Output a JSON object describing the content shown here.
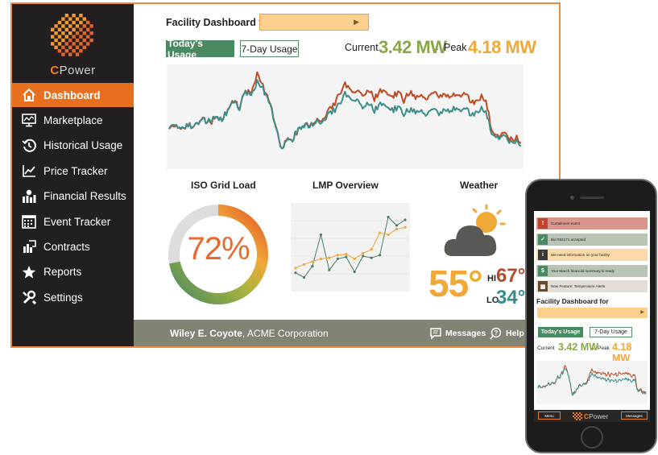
{
  "brand": {
    "logo_c": "C",
    "logo_rest": "Power"
  },
  "sidebar": {
    "items": [
      {
        "label": "Dashboard",
        "icon": "home-icon",
        "active": true
      },
      {
        "label": "Marketplace",
        "icon": "monitor-chart-icon"
      },
      {
        "label": "Historical Usage",
        "icon": "history-icon"
      },
      {
        "label": "Price Tracker",
        "icon": "trend-line-icon"
      },
      {
        "label": "Financial Results",
        "icon": "money-bars-icon"
      },
      {
        "label": "Event Tracker",
        "icon": "calendar-grid-icon"
      },
      {
        "label": "Contracts",
        "icon": "contract-icon"
      },
      {
        "label": "Reports",
        "icon": "star-icon"
      },
      {
        "label": "Settings",
        "icon": "tools-icon"
      }
    ]
  },
  "main": {
    "title": "Facility Dashboard for",
    "tabs": [
      "Today's Usage",
      "7-Day Usage"
    ],
    "current_label": "Current",
    "current_value": "3.42 MW",
    "peak_label": "Peak",
    "peak_value": "4.18 MW",
    "panels": {
      "grid_title": "ISO Grid Load",
      "lmp_title": "LMP Overview",
      "weather_title": "Weather"
    },
    "grid_load": {
      "value": "72%",
      "fraction": 0.72
    },
    "weather": {
      "temp": "55°",
      "hi_label": "HI",
      "hi": "67°",
      "lo_label": "LO",
      "lo": "34°"
    }
  },
  "footer": {
    "user_name": "Wiley E. Coyote",
    "company": ", ACME Corporation",
    "messages": "Messages",
    "help": "Help"
  },
  "mobile": {
    "alerts": [
      {
        "text": "Curtailment event",
        "color": "#d9968a",
        "icon": "warning-icon"
      },
      {
        "text": "Bid #82171 accepted",
        "color": "#b8c4b4",
        "icon": "check-icon"
      },
      {
        "text": "We need information on your facility",
        "color": "#fcd9a8",
        "icon": "info-icon"
      },
      {
        "text": "Your March financial summary is ready",
        "color": "#b8c4b4",
        "icon": "money-bars-icon"
      },
      {
        "text": "New Feature: Temperature Alerts",
        "color": "#e2ddd6",
        "icon": "feature-icon"
      }
    ],
    "title": "Facility Dashboard for",
    "tabs": [
      "Today's Usage",
      "7-Day Usage"
    ],
    "current_label": "Current",
    "current_value": "3.42 MW",
    "peak_label": "Peak",
    "peak_value": "4.18 MW",
    "menu": "Menu",
    "messages": "Messages"
  },
  "colors": {
    "accent": "#e76f1d",
    "green": "#4a8a62",
    "teal": "#3a8f8a",
    "rust": "#c24a22",
    "orange": "#f0a836",
    "footer": "#818473"
  },
  "chart_data": [
    {
      "type": "line",
      "title": "Today's Usage",
      "x": [
        0,
        1,
        2,
        3,
        4,
        5,
        6,
        7,
        8,
        9,
        10,
        11,
        12,
        13,
        14,
        15,
        16,
        17,
        18,
        19,
        20,
        21,
        22,
        23,
        24,
        25,
        26,
        27,
        28,
        29,
        30,
        31,
        32,
        33,
        34,
        35,
        36,
        37,
        38,
        39,
        40,
        41,
        42,
        43,
        44,
        45,
        46,
        47,
        48,
        49,
        50,
        51,
        52,
        53,
        54,
        55,
        56,
        57,
        58,
        59,
        60
      ],
      "series": [
        {
          "values": [
            0.62,
            0.58,
            0.64,
            0.57,
            0.6,
            0.55,
            0.52,
            0.56,
            0.5,
            0.53,
            0.44,
            0.36,
            0.42,
            0.25,
            0.28,
            0.14,
            0.22,
            0.33,
            0.55,
            0.82,
            0.76,
            0.72,
            0.63,
            0.58,
            0.6,
            0.54,
            0.57,
            0.5,
            0.44,
            0.36,
            0.28,
            0.35,
            0.33,
            0.4,
            0.37,
            0.43,
            0.37,
            0.42,
            0.44,
            0.41,
            0.47,
            0.42,
            0.45,
            0.43,
            0.48,
            0.44,
            0.46,
            0.42,
            0.44,
            0.4,
            0.43,
            0.45,
            0.5,
            0.42,
            0.44,
            0.66,
            0.72,
            0.68,
            0.76,
            0.74,
            0.79
          ]
        },
        {
          "values": [
            0.63,
            0.59,
            0.64,
            0.58,
            0.6,
            0.55,
            0.52,
            0.57,
            0.5,
            0.53,
            0.43,
            0.35,
            0.41,
            0.24,
            0.26,
            0.05,
            0.2,
            0.32,
            0.54,
            0.82,
            0.75,
            0.72,
            0.64,
            0.57,
            0.59,
            0.53,
            0.55,
            0.47,
            0.38,
            0.27,
            0.18,
            0.26,
            0.24,
            0.28,
            0.24,
            0.31,
            0.24,
            0.28,
            0.31,
            0.26,
            0.33,
            0.25,
            0.3,
            0.27,
            0.33,
            0.27,
            0.29,
            0.27,
            0.3,
            0.26,
            0.28,
            0.31,
            0.38,
            0.3,
            0.33,
            0.63,
            0.7,
            0.65,
            0.73,
            0.71,
            0.76
          ]
        }
      ]
    },
    {
      "type": "line",
      "title": "LMP Overview",
      "x": [
        0,
        1,
        2,
        3,
        4,
        5,
        6,
        7,
        8,
        9,
        10,
        11,
        12,
        13
      ],
      "series": [
        {
          "values": [
            1.5,
            1.0,
            2.2,
            5.6,
            1.8,
            3.0,
            3.2,
            1.6,
            3.3,
            3.1,
            3.4,
            7.5,
            6.6,
            7.2
          ]
        },
        {
          "values": [
            2.0,
            2.4,
            2.7,
            3.0,
            3.1,
            3.4,
            3.5,
            3.0,
            3.6,
            4.0,
            5.8,
            5.6,
            6.2,
            6.4
          ]
        }
      ]
    }
  ]
}
